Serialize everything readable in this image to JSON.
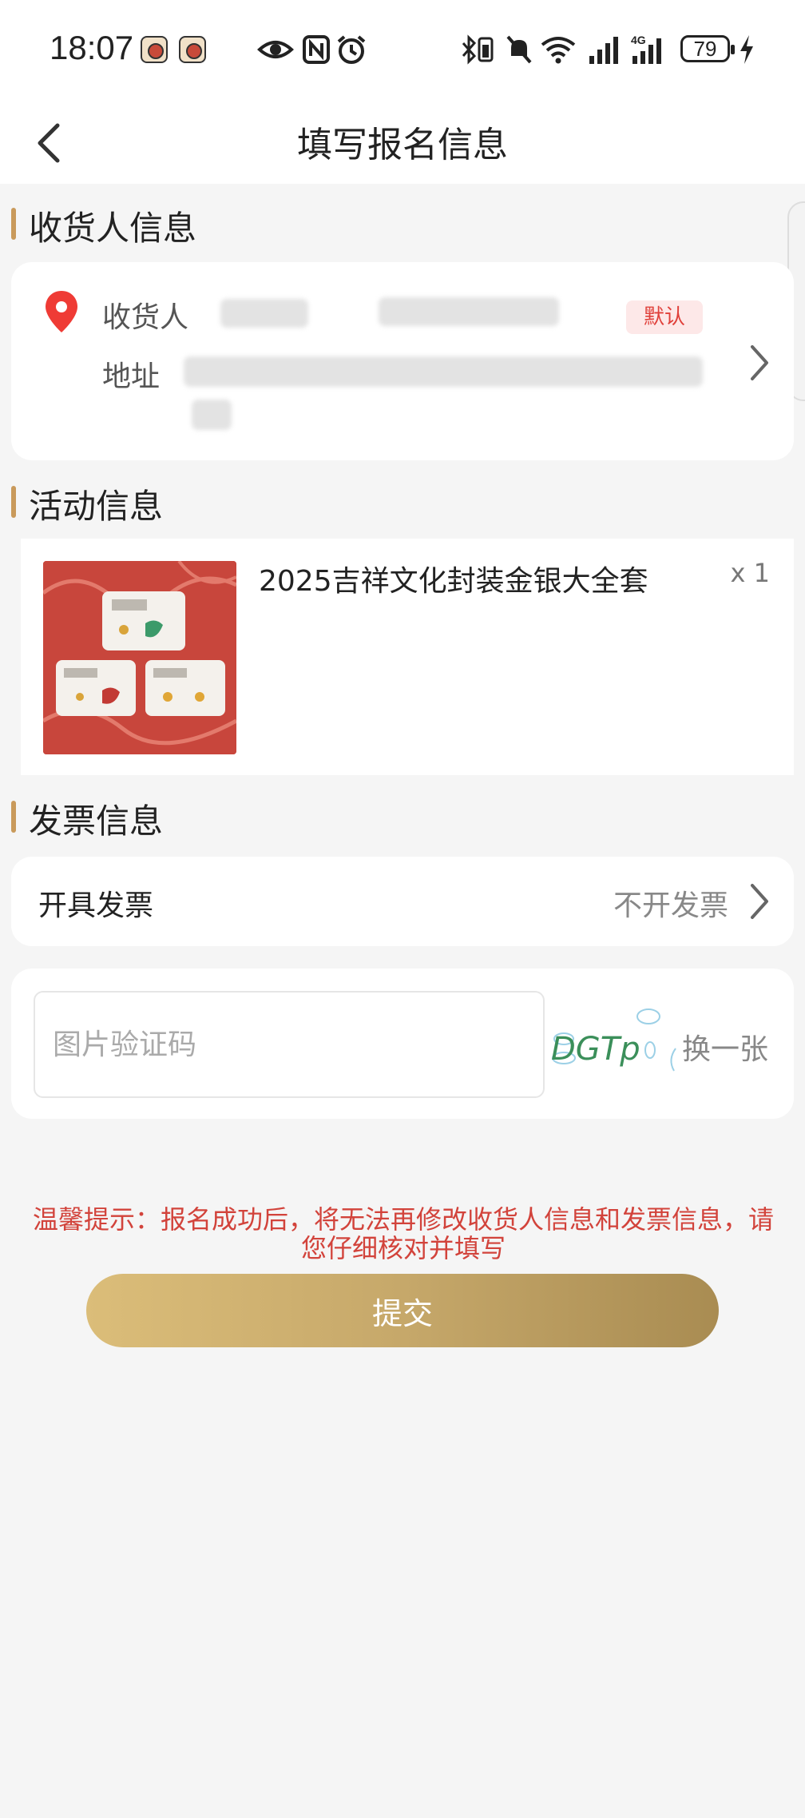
{
  "status_bar": {
    "time": "18:07",
    "battery": "79",
    "network": "4G"
  },
  "header": {
    "title": "填写报名信息"
  },
  "consignee": {
    "section_title": "收货人信息",
    "name_label": "收货人",
    "address_label": "地址",
    "default_badge": "默认"
  },
  "activity": {
    "section_title": "活动信息",
    "product_name": "2025吉祥文化封装金银大全套",
    "quantity": "x 1"
  },
  "invoice": {
    "section_title": "发票信息",
    "label": "开具发票",
    "value": "不开发票"
  },
  "captcha": {
    "placeholder": "图片验证码",
    "code": "DGTp",
    "refresh_label": "换一张"
  },
  "tip": "温馨提示：报名成功后，将无法再修改收货人信息和发票信息，请您仔细核对并填写",
  "submit_label": "提交",
  "colors": {
    "accent_bar": "#c99a5b",
    "tip_red": "#d2433b",
    "badge_red": "#e0403a",
    "button_gold_start": "#dbbd79",
    "button_gold_end": "#a98c52"
  }
}
